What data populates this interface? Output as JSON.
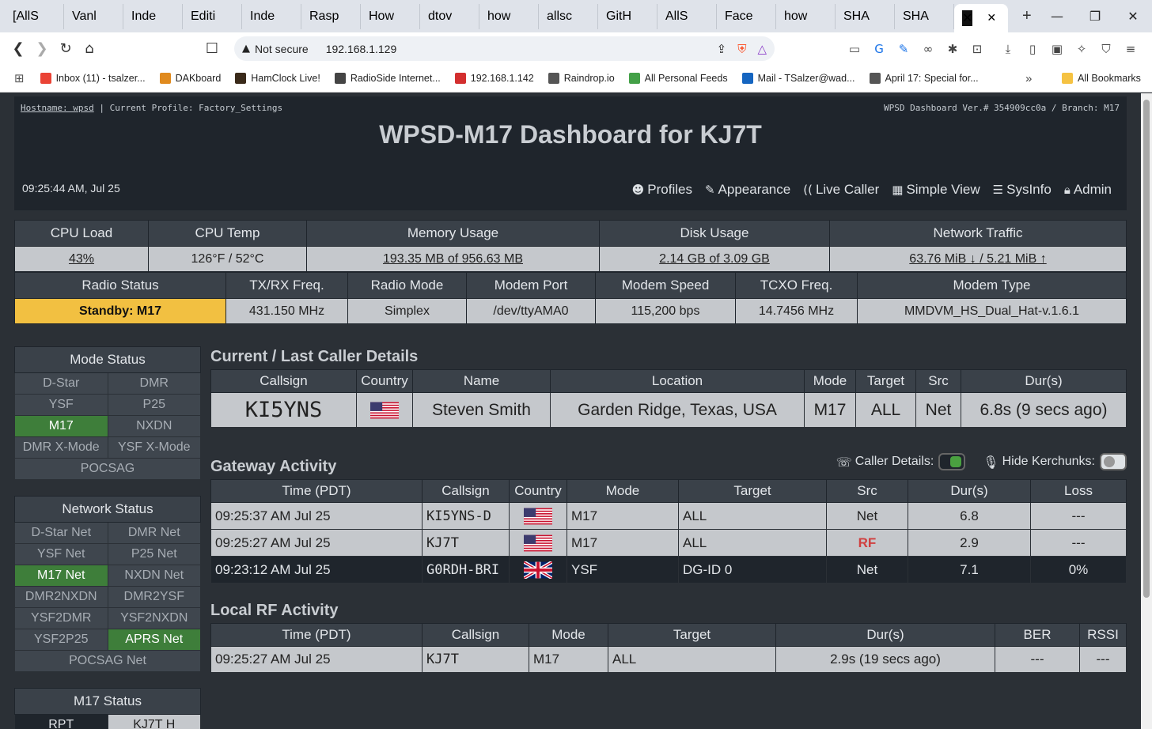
{
  "browser": {
    "tabs": [
      {
        "label": "[AllS",
        "icon": "gmail-icon",
        "color": "#ea4335"
      },
      {
        "label": "Vanl",
        "icon": "vanlife-icon",
        "color": "#6b5b2e"
      },
      {
        "label": "Inde",
        "icon": "globe-icon",
        "color": "#555555"
      },
      {
        "label": "Editi",
        "icon": "wire-icon",
        "color": "#c33"
      },
      {
        "label": "Inde",
        "icon": "m-icon",
        "color": "#222222"
      },
      {
        "label": "Rasp",
        "icon": "d-icon",
        "color": "#e3342f"
      },
      {
        "label": "How",
        "icon": "c-icon",
        "color": "#f5c400"
      },
      {
        "label": "dtov",
        "icon": "google-icon",
        "color": "#4285f4"
      },
      {
        "label": "how",
        "icon": "raspberry-icon",
        "color": "#c51a4a"
      },
      {
        "label": "allsc",
        "icon": "google-icon",
        "color": "#4285f4"
      },
      {
        "label": "GitH",
        "icon": "github-icon",
        "color": "#222222"
      },
      {
        "label": "AllS",
        "icon": "allstar-icon",
        "color": "#b9a6e0"
      },
      {
        "label": "Face",
        "icon": "facebook-icon",
        "color": "#1877f2"
      },
      {
        "label": "how",
        "icon": "google-icon",
        "color": "#4285f4"
      },
      {
        "label": "SHA",
        "icon": "mail-icon",
        "color": "#1e88e5"
      },
      {
        "label": "SHA",
        "icon": "mail-icon",
        "color": "#1e88e5"
      }
    ],
    "active_tab_icon": "wpsd-icon",
    "omnibox": {
      "security": "Not secure",
      "url": "192.168.1.129"
    },
    "bookmarks": [
      {
        "label": "Inbox (11) - tsalzer...",
        "color": "#ea4335"
      },
      {
        "label": "DAKboard",
        "color": "#e08a1e"
      },
      {
        "label": "HamClock Live!",
        "color": "#3a2a1a"
      },
      {
        "label": "RadioSide Internet...",
        "color": "#444444"
      },
      {
        "label": "192.168.1.142",
        "color": "#d32f2f"
      },
      {
        "label": "Raindrop.io",
        "color": "#555555"
      },
      {
        "label": "All Personal Feeds",
        "color": "#43a047"
      },
      {
        "label": "Mail - TSalzer@wad...",
        "color": "#1565c0"
      },
      {
        "label": "April 17: Special for...",
        "color": "#555555"
      }
    ],
    "all_bookmarks": "All Bookmarks"
  },
  "header": {
    "hostname_label": "Hostname: wpsd",
    "profile": " | Current Profile: Factory_Settings",
    "version": "WPSD Dashboard Ver.# 354909cc0a / Branch: M17",
    "title": "WPSD-M17 Dashboard for KJ7T",
    "datetime": "09:25:44 AM, Jul 25",
    "nav": {
      "profiles": "Profiles",
      "appearance": "Appearance",
      "live_caller": "Live Caller",
      "simple_view": "Simple View",
      "sysinfo": "SysInfo",
      "admin": "Admin"
    }
  },
  "system": {
    "headers": [
      "CPU Load",
      "CPU Temp",
      "Memory Usage",
      "Disk Usage",
      "Network Traffic"
    ],
    "cpu_load": "43%",
    "cpu_temp": "126°F / 52°C",
    "memory": "193.35 MB of 956.63 MB",
    "disk": "2.14 GB of 3.09 GB",
    "network": "63.76 MiB ↓ / 5.21 MiB ↑"
  },
  "radio": {
    "headers": [
      "Radio Status",
      "TX/RX Freq.",
      "Radio Mode",
      "Modem Port",
      "Modem Speed",
      "TCXO Freq.",
      "Modem Type"
    ],
    "status": "Standby: M17",
    "freq": "431.150 MHz",
    "mode": "Simplex",
    "port": "/dev/ttyAMA0",
    "speed": "115,200 bps",
    "tcxo": "14.7456 MHz",
    "type": "MMDVM_HS_Dual_Hat-v.1.6.1",
    "standby_color": "#f2c041"
  },
  "mode_status": {
    "title": "Mode Status",
    "rows": [
      [
        "D-Star",
        "DMR"
      ],
      [
        "YSF",
        "P25"
      ],
      [
        "M17",
        "NXDN"
      ],
      [
        "DMR X-Mode",
        "YSF X-Mode"
      ]
    ],
    "last": "POCSAG"
  },
  "network_status": {
    "title": "Network Status",
    "rows": [
      [
        "D-Star Net",
        "DMR Net"
      ],
      [
        "YSF Net",
        "P25 Net"
      ],
      [
        "M17 Net",
        "NXDN Net"
      ],
      [
        "DMR2NXDN",
        "DMR2YSF"
      ],
      [
        "YSF2DMR",
        "YSF2NXDN"
      ],
      [
        "YSF2P25",
        "APRS Net"
      ]
    ],
    "last": "POCSAG Net"
  },
  "m17_status": {
    "title": "M17 Status",
    "rpt": "RPT",
    "rpt_val": "KJ7T H"
  },
  "caller": {
    "title": "Current / Last Caller Details",
    "headers": [
      "Callsign",
      "Country",
      "Name",
      "Location",
      "Mode",
      "Target",
      "Src",
      "Dur(s)"
    ],
    "callsign": "KI5YNS",
    "name": "Steven Smith",
    "location": "Garden Ridge, Texas, USA",
    "mode": "M17",
    "target": "ALL",
    "src": "Net",
    "dur": "6.8s (9 secs ago)"
  },
  "gateway": {
    "title": "Gateway Activity",
    "caller_details_label": "Caller Details:",
    "hide_kerchunks_label": "Hide Kerchunks:",
    "headers": [
      "Time (PDT)",
      "Callsign",
      "Country",
      "Mode",
      "Target",
      "Src",
      "Dur(s)",
      "Loss"
    ],
    "rows": [
      {
        "time": "09:25:37 AM Jul 25",
        "call": "KI5YNS",
        "suffix": "-D",
        "flag": "us",
        "mode": "M17",
        "target": "ALL",
        "src": "Net",
        "dur": "6.8",
        "loss": "---"
      },
      {
        "time": "09:25:27 AM Jul 25",
        "call": "KJ7T",
        "suffix": "",
        "flag": "us",
        "mode": "M17",
        "target": "ALL",
        "src": "RF",
        "dur": "2.9",
        "loss": "---"
      },
      {
        "time": "09:23:12 AM Jul 25",
        "call": "G0RDH-BRI",
        "suffix": "",
        "flag": "uk",
        "mode": "YSF",
        "target": "DG-ID 0",
        "src": "Net",
        "dur": "7.1",
        "loss": "0%"
      }
    ]
  },
  "localrf": {
    "title": "Local RF Activity",
    "headers": [
      "Time (PDT)",
      "Callsign",
      "Mode",
      "Target",
      "Dur(s)",
      "BER",
      "RSSI"
    ],
    "rows": [
      {
        "time": "09:25:27 AM Jul 25",
        "call": "KJ7T",
        "mode": "M17",
        "target": "ALL",
        "dur": "2.9s (19 secs ago)",
        "ber": "---",
        "rssi": "---"
      }
    ]
  }
}
